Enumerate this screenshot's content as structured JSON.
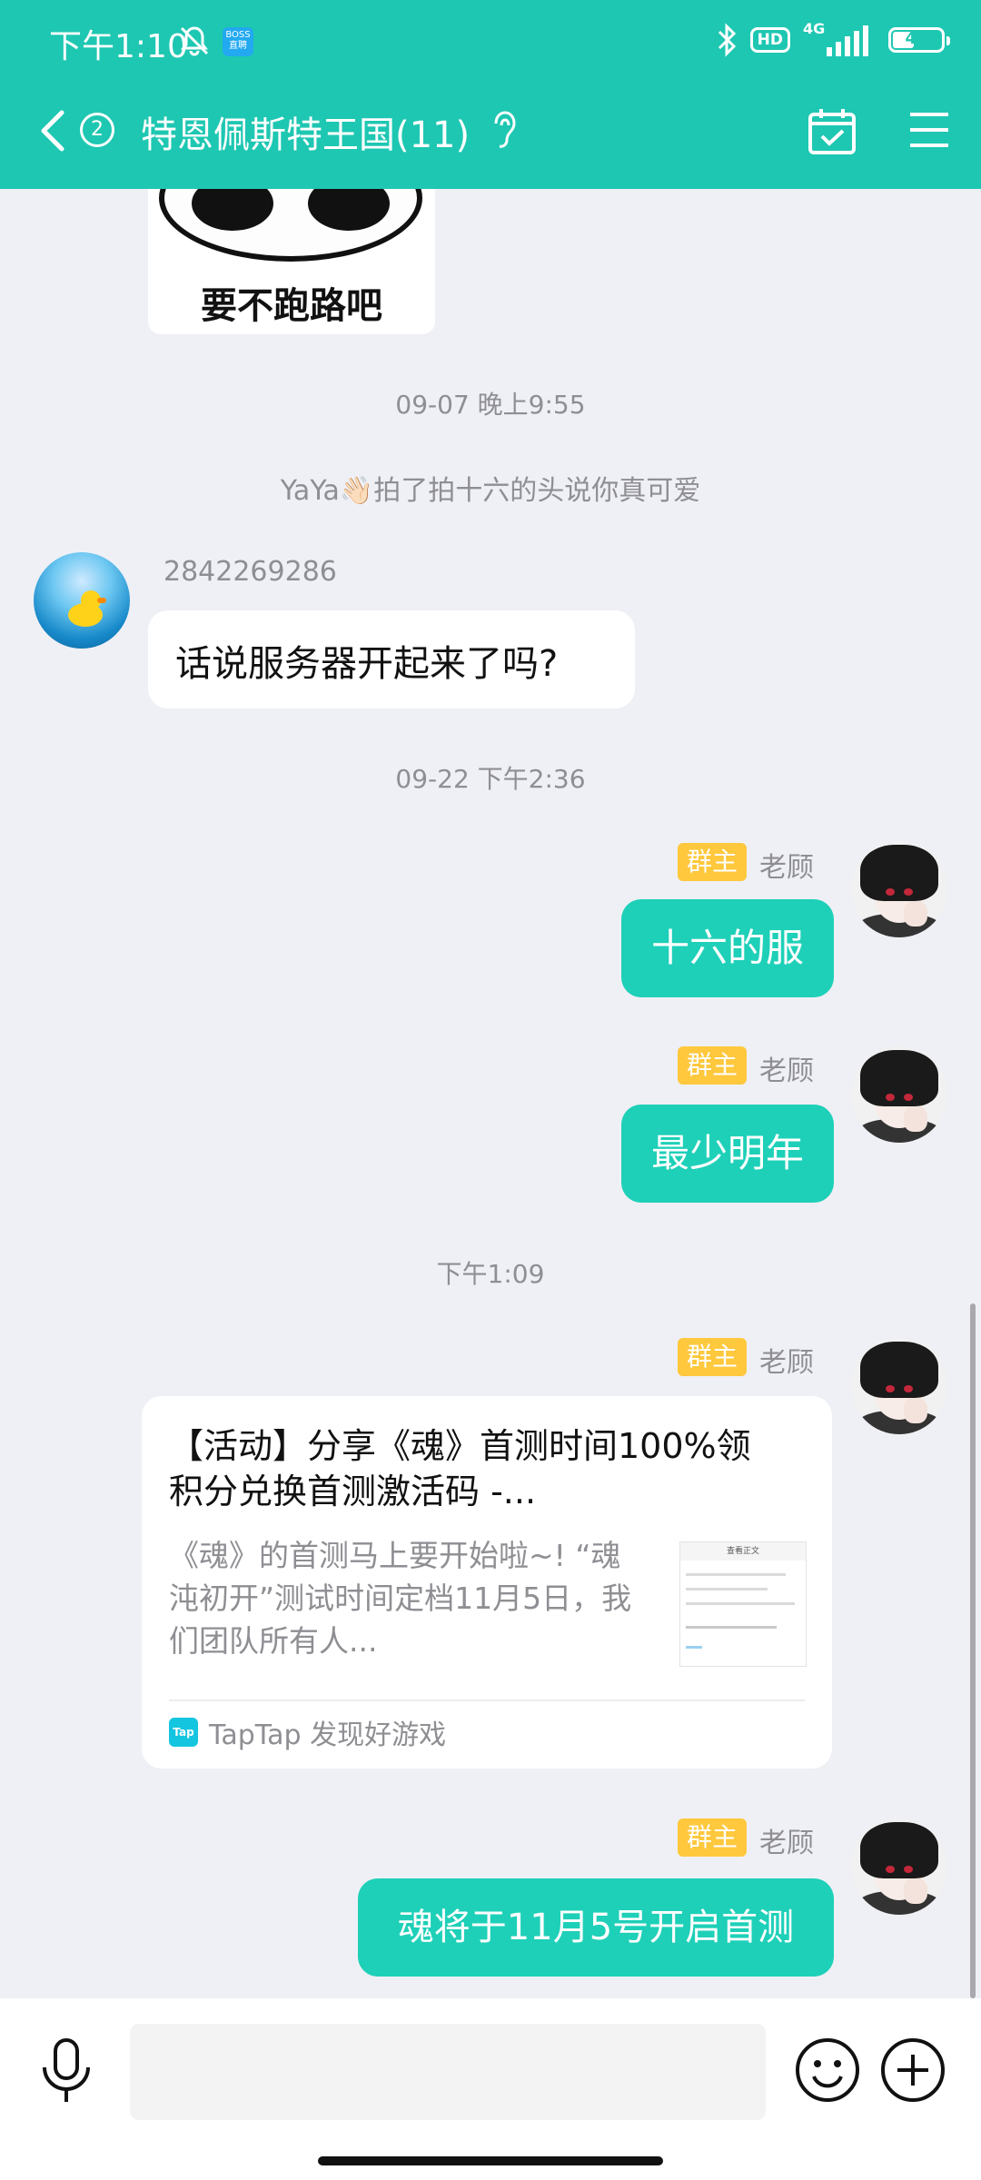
{
  "status_bar": {
    "time": "下午1:10",
    "notif_badge": "BOSS 直聘",
    "hd": "HD",
    "network": "4G",
    "battery": "46",
    "battery_level_percent": 46
  },
  "header": {
    "unread_count": "2",
    "title": "特恩佩斯特王国(11)"
  },
  "messages": {
    "meme_caption": "要不跑路吧",
    "ts1": "09-07 晚上9:55",
    "system_note": "YaYa👋🏻拍了拍十六的头说你真可爱",
    "m1_sender": "2842269286",
    "m1_text": "话说服务器开起来了吗?",
    "ts2": "09-22 下午2:36",
    "owner_badge": "群主",
    "owner_name": "老顾",
    "m2_text": "十六的服",
    "m3_text": "最少明年",
    "ts3": "下午1:09",
    "card_title": "【活动】分享《魂》首测时间100%领积分兑换首测激活码 -...",
    "card_desc": "《魂》的首测马上要开始啦~! “魂沌初开”测试时间定档11月5日，我们团队所有人...",
    "card_thumb_title": "查看正文",
    "card_source": "TapTap 发现好游戏",
    "tap_logo": "Tap",
    "m5_text": "魂将于11月5号开启首测"
  },
  "colors": {
    "primary": "#1ec7b2",
    "bubble_self": "#1ed0b8",
    "owner_badge": "#ffc83d",
    "background": "#eff0f5"
  },
  "icons": [
    "back-icon",
    "ear-icon",
    "calendar-check-icon",
    "menu-icon",
    "mic-icon",
    "emoji-icon",
    "plus-icon",
    "bluetooth-icon",
    "bell-muted-icon"
  ]
}
